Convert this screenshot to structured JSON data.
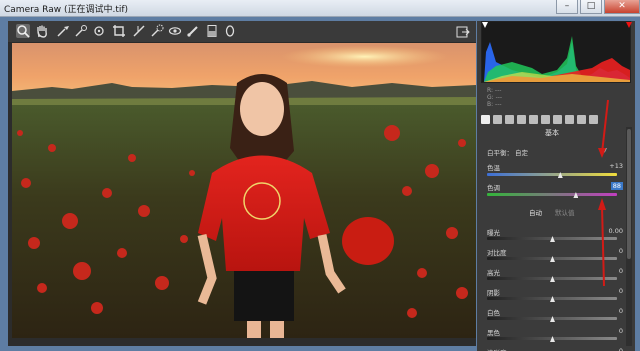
{
  "window": {
    "title": "Camera Raw (正在调试中.tif)",
    "buttons": [
      "–",
      "□",
      "✕"
    ]
  },
  "toolbar": {
    "icons": [
      "zoom-icon",
      "hand-icon",
      "white-balance-icon",
      "color-sampler-icon",
      "target-adjust-icon",
      "crop-icon",
      "straighten-icon",
      "spot-removal-icon",
      "red-eye-icon",
      "adjustment-brush-icon",
      "graduated-filter-icon",
      "radial-filter-icon"
    ],
    "right_icon": "open-preferences-icon"
  },
  "histogram": {
    "readouts": [
      "R: ---",
      "G: ---",
      "B: ---"
    ]
  },
  "panel": {
    "section_title": "基本",
    "white_balance": {
      "label": "白平衡：",
      "value": "自定"
    },
    "temperature": {
      "label": "色温",
      "value": "+13",
      "level": 0.56
    },
    "tint": {
      "label": "色调",
      "value": "88",
      "level": 0.68
    },
    "auto": "自动",
    "default": "默认值",
    "sliders": [
      {
        "label": "曝光",
        "value": "0.00",
        "level": 0.5
      },
      {
        "label": "对比度",
        "value": "0",
        "level": 0.5
      },
      {
        "label": "高光",
        "value": "0",
        "level": 0.5
      },
      {
        "label": "阴影",
        "value": "0",
        "level": 0.5
      },
      {
        "label": "白色",
        "value": "0",
        "level": 0.5
      },
      {
        "label": "黑色",
        "value": "0",
        "level": 0.5
      },
      {
        "label": "清晰度",
        "value": "0",
        "level": 0.5
      }
    ]
  },
  "colors": {
    "accent": "#d21b16",
    "highlight": "#3b79c9",
    "frame": "#5e7da3"
  }
}
